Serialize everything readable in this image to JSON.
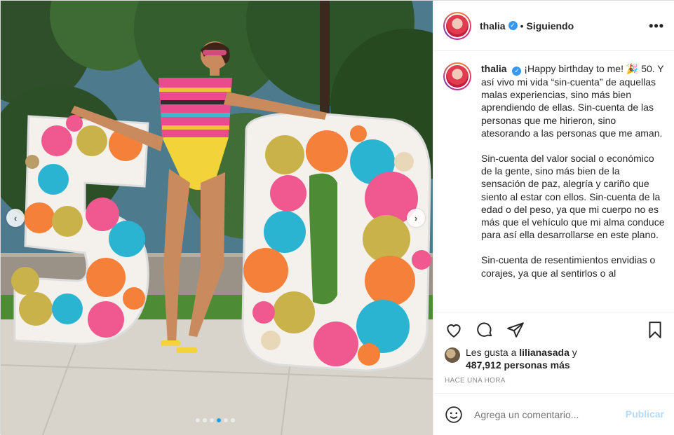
{
  "post": {
    "username": "thalia",
    "separator": "•",
    "follow_status": "Siguiendo",
    "more_label": "•••"
  },
  "caption": {
    "username": "thalia",
    "paragraphs": [
      "¡Happy birthday to me! 🎉 50. Y así vivo mi vida “sin-cuenta” de aquellas malas experiencias, sino más bien aprendiendo de ellas. Sin-cuenta de las personas que me hirieron, sino atesorando a las personas que me aman.",
      "Sin-cuenta del valor social o económico de la gente, sino más bien de la sensación de paz, alegría y cariño que siento al estar con ellos. Sin-cuenta de la edad o del peso, ya que mi cuerpo no es más que el vehículo que mi alma conduce para así ella desarrollarse en este plano.",
      "Sin-cuenta de resentimientos envidias o corajes, ya que al sentirlos o al"
    ]
  },
  "likes": {
    "prefix": "Les gusta a ",
    "user": "lilianasada",
    "connector": " y",
    "count": "487,912 personas más"
  },
  "timestamp": "HACE UNA HORA",
  "comment_box": {
    "placeholder": "Agrega un comentario...",
    "publish_label": "Publicar"
  },
  "carousel": {
    "prev_icon": "chevron-left-icon",
    "next_icon": "chevron-right-icon",
    "total_slides": 6,
    "active_slide": 4
  },
  "colors": {
    "verified": "#3897f0",
    "publish_disabled": "#b3dbff",
    "text_primary": "#262626",
    "text_secondary": "#8e8e8e"
  }
}
